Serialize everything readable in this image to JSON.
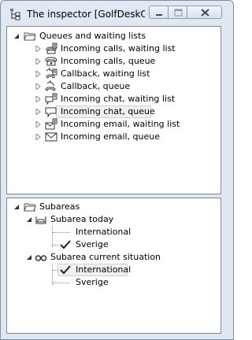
{
  "window": {
    "title": "The inspector [GolfDeskO...",
    "icon": "tree-hierarchy-icon",
    "controls": [
      "minimize",
      "maximize",
      "close"
    ]
  },
  "top_tree": {
    "root": {
      "label": "Queues and waiting lists",
      "icon": "folder-open-icon",
      "expanded": true
    },
    "items": [
      {
        "label": "Incoming calls, waiting list",
        "icon": "phone-list-icon"
      },
      {
        "label": "Incoming calls, queue",
        "icon": "phone-icon"
      },
      {
        "label": "Callback, waiting list",
        "icon": "callback-list-icon"
      },
      {
        "label": "Callback, queue",
        "icon": "callback-icon"
      },
      {
        "label": "Incoming chat, waiting list",
        "icon": "chat-list-icon"
      },
      {
        "label": "Incoming chat, queue",
        "icon": "chat-icon",
        "selected": true
      },
      {
        "label": "Incoming email, waiting list",
        "icon": "email-list-icon"
      },
      {
        "label": "Incoming email, queue",
        "icon": "email-icon"
      }
    ]
  },
  "bottom_tree": {
    "root": {
      "label": "Subareas",
      "icon": "folder-open-icon",
      "expanded": true
    },
    "groups": [
      {
        "label": "Subarea today",
        "icon": "sofa-icon",
        "expanded": true,
        "children": [
          {
            "label": "International",
            "checked": false
          },
          {
            "label": "Sverige",
            "checked": true
          }
        ]
      },
      {
        "label": "Subarea current situation",
        "icon": "glasses-icon",
        "expanded": true,
        "children": [
          {
            "label": "International",
            "checked": true,
            "selected": true
          },
          {
            "label": "Sverige",
            "checked": false
          }
        ]
      }
    ]
  }
}
